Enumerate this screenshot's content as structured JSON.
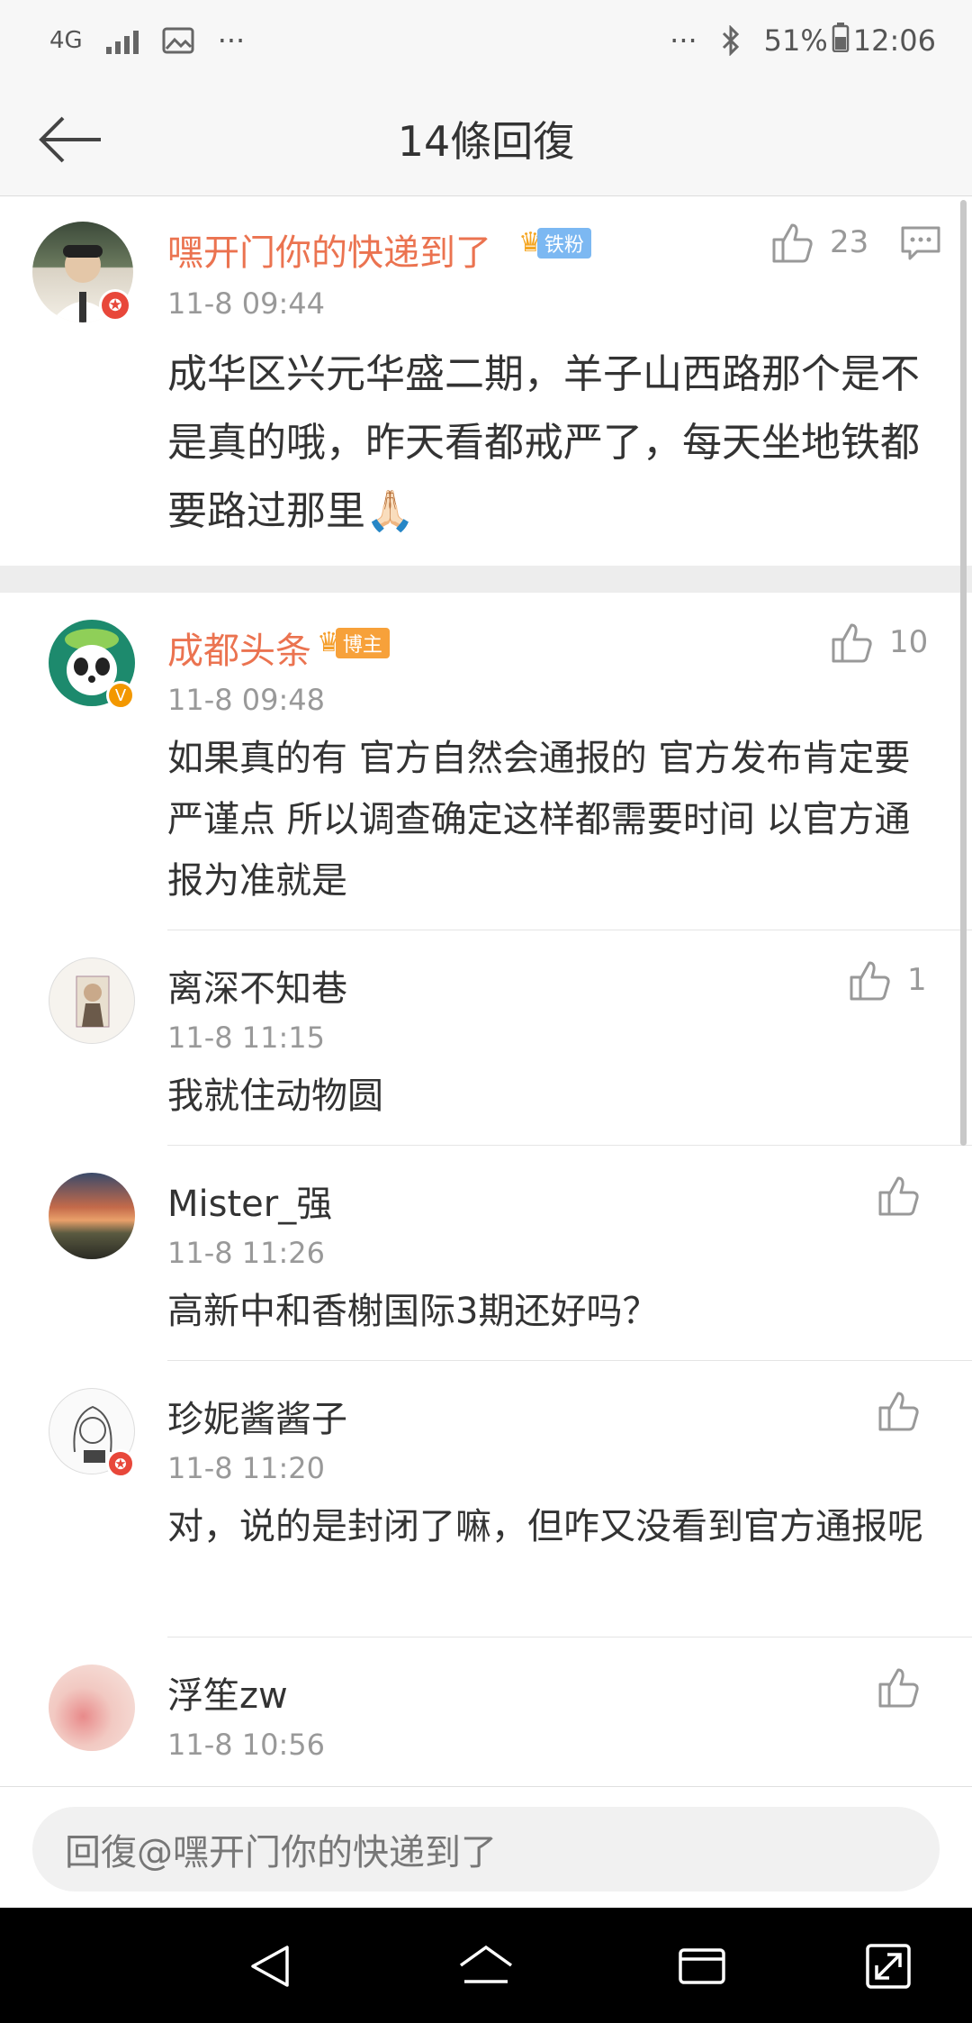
{
  "status_bar": {
    "network": "4G",
    "more": "···",
    "right_more": "···",
    "battery": "51%",
    "time": "12:06"
  },
  "nav": {
    "title": "14條回復"
  },
  "main_comment": {
    "username": "嘿开门你的快递到了",
    "badge": "铁粉",
    "likes": "23",
    "time": "11-8 09:44",
    "text": "成华区兴元华盛二期，羊子山西路那个是不是真的哦，昨天看都戒严了，每天坐地铁都要路过那里🙏🏻"
  },
  "replies": [
    {
      "username": "成都头条",
      "badge": "博主",
      "likes": "10",
      "time": "11-8 09:48",
      "text": "如果真的有 官方自然会通报的 官方发布肯定要严谨点 所以调查确定这样都需要时间 以官方通报为准就是"
    },
    {
      "username": "离深不知巷",
      "likes": "1",
      "time": "11-8 11:15",
      "text": "我就住动物圆"
    },
    {
      "username": "Mister_强",
      "likes": "",
      "time": "11-8 11:26",
      "text": "高新中和香榭国际3期还好吗？"
    },
    {
      "username": "珍妮酱酱子",
      "likes": "",
      "time": "11-8 11:20",
      "text": "对，说的是封闭了嘛，但咋又没看到官方通报呢"
    },
    {
      "username": "浮笙zw",
      "likes": "",
      "time": "11-8 10:56",
      "text": ""
    }
  ],
  "input": {
    "placeholder": "回復@嘿开门你的快递到了"
  },
  "colors": {
    "accent_orange": "#eb7350",
    "badge_red": "#e8473a",
    "badge_orange": "#f39800"
  }
}
